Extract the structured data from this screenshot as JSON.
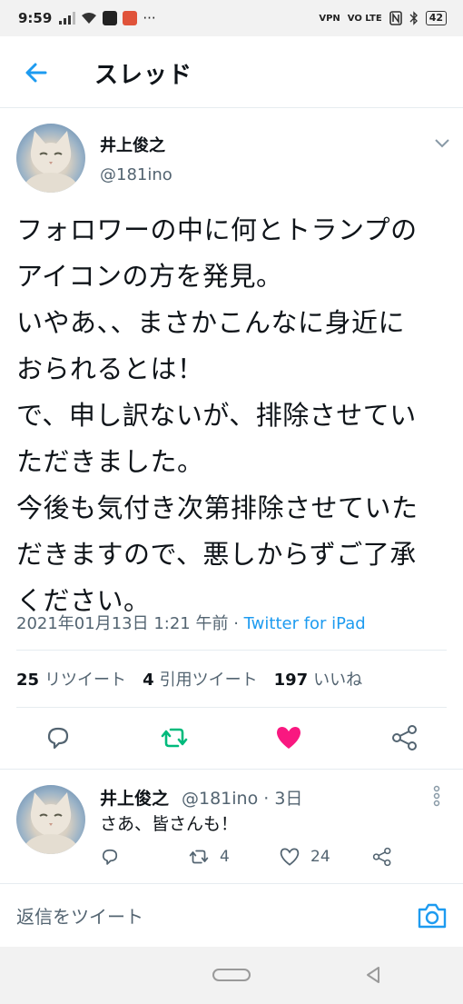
{
  "status_bar": {
    "time": "9:59",
    "battery": "42",
    "vpn_label": "VPN",
    "volte_label": "VO LTE",
    "more": "···"
  },
  "header": {
    "title": "スレッド",
    "back_icon": "arrow-left-icon"
  },
  "tweet": {
    "author_name": "井上俊之",
    "author_handle": "@181ino",
    "text": "フォロワーの中に何とトランプの\nアイコンの方を発見。\nいやあ、、まさかこんなに身近に\nおられるとは！\nで、申し訳ないが、排除させてい\nただきました。\n今後も気付き次第排除させていた\nだきますので、悪しからずご了承\nください。",
    "timestamp": "2021年01月13日 1:21 午前",
    "separator": " · ",
    "source": "Twitter for iPad",
    "retweets_count": "25",
    "retweets_label": "リツイート",
    "quotes_count": "4",
    "quotes_label": "引用ツイート",
    "likes_count": "197",
    "likes_label": "いいね"
  },
  "reply": {
    "author_name": "井上俊之",
    "author_handle": "@181ino · 3日",
    "text": "さあ、皆さんも！",
    "retweets": "4",
    "likes": "24"
  },
  "compose": {
    "placeholder": "返信をツイート"
  },
  "colors": {
    "accent": "#1d9bf0",
    "retweet_green": "#00ba7c",
    "like_pink": "#f91880"
  }
}
